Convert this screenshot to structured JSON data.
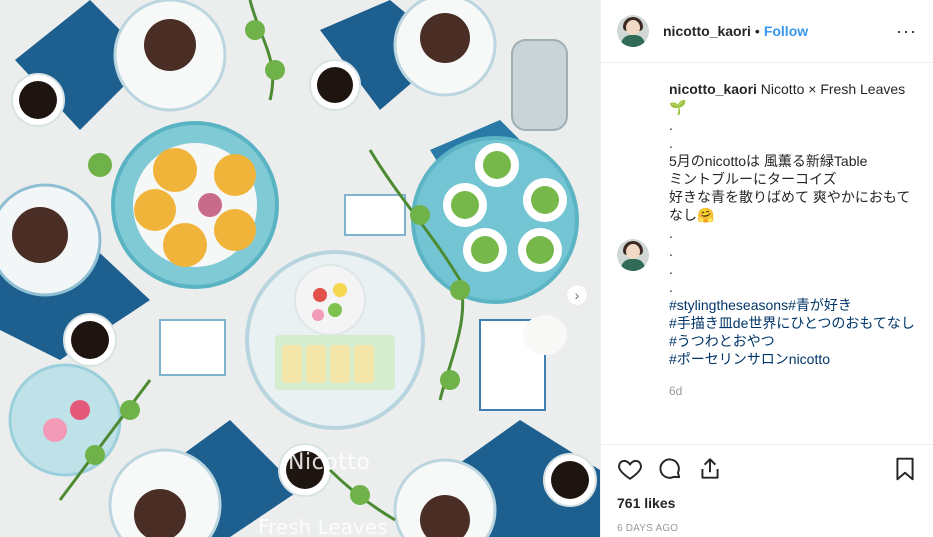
{
  "photo": {
    "watermark_top": "Nicotto",
    "watermark_bottom": "Fresh Leaves",
    "next_arrow": "›"
  },
  "header": {
    "username": "nicotto_kaori",
    "separator": "•",
    "follow_label": "Follow",
    "more_label": "···"
  },
  "caption": {
    "username": "nicotto_kaori",
    "lines": [
      "Nicotto × Fresh Leaves",
      ".",
      ".",
      "5月のnicottoは 風薫る新緑Table",
      "ミントブルーにターコイズ",
      "好きな青を散りばめて 爽やかにおもてなし🤗",
      ".",
      ".",
      ".",
      "."
    ],
    "leaf_emoji": "🌱",
    "hashtags": [
      "#stylingtheseasons#青が好き",
      "#手描き皿de世界にひとつのおもてなし",
      "#うつわとおやつ",
      "#ポーセリンサロンnicotto"
    ],
    "age": "6d"
  },
  "actions": {
    "likes": "761 likes",
    "posted": "6 DAYS AGO"
  }
}
